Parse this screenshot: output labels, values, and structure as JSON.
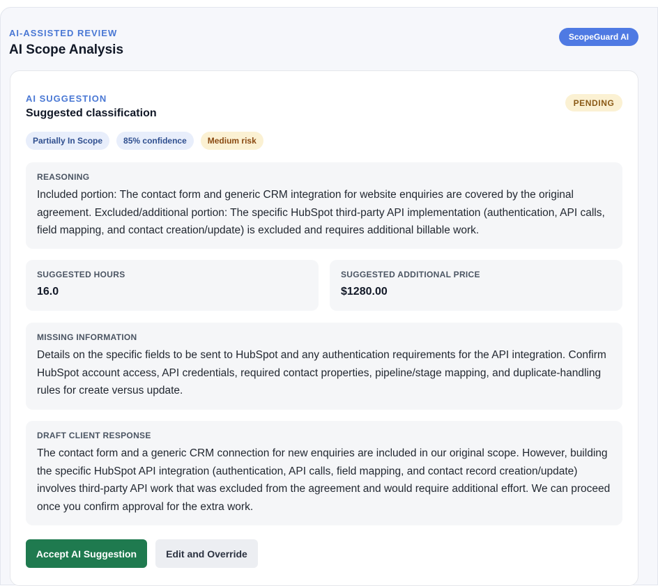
{
  "header": {
    "eyebrow": "AI-ASSISTED REVIEW",
    "title": "AI Scope Analysis",
    "brand_badge": "ScopeGuard AI"
  },
  "suggestion": {
    "eyebrow": "AI SUGGESTION",
    "title": "Suggested classification",
    "status": "PENDING",
    "chips": {
      "classification": "Partially In Scope",
      "confidence": "85% confidence",
      "risk": "Medium risk"
    },
    "reasoning": {
      "label": "REASONING",
      "text": "Included portion: The contact form and generic CRM integration for website enquiries are covered by the original agreement. Excluded/additional portion: The specific HubSpot third-party API implementation (authentication, API calls, field mapping, and contact creation/update) is excluded and requires additional billable work."
    },
    "hours": {
      "label": "SUGGESTED HOURS",
      "value": "16.0"
    },
    "price": {
      "label": "SUGGESTED ADDITIONAL PRICE",
      "value": "$1280.00"
    },
    "missing_info": {
      "label": "MISSING INFORMATION",
      "text": "Details on the specific fields to be sent to HubSpot and any authentication requirements for the API integration. Confirm HubSpot account access, API credentials, required contact properties, pipeline/stage mapping, and duplicate-handling rules for create versus update."
    },
    "draft_response": {
      "label": "DRAFT CLIENT RESPONSE",
      "text": "The contact form and a generic CRM connection for new enquiries are included in our original scope. However, building the specific HubSpot API integration (authentication, API calls, field mapping, and contact record creation/update) involves third-party API work that was excluded from the agreement and would require additional effort. We can proceed once you confirm approval for the extra work."
    },
    "actions": {
      "accept_label": "Accept AI Suggestion",
      "override_label": "Edit and Override"
    }
  },
  "colors": {
    "accent": "#4a78d4",
    "brand_badge": "#4f7ae3",
    "accept_button": "#1f7a4f",
    "pending_bg": "#fbf1d3",
    "risk_bg": "#fbf1d3"
  }
}
